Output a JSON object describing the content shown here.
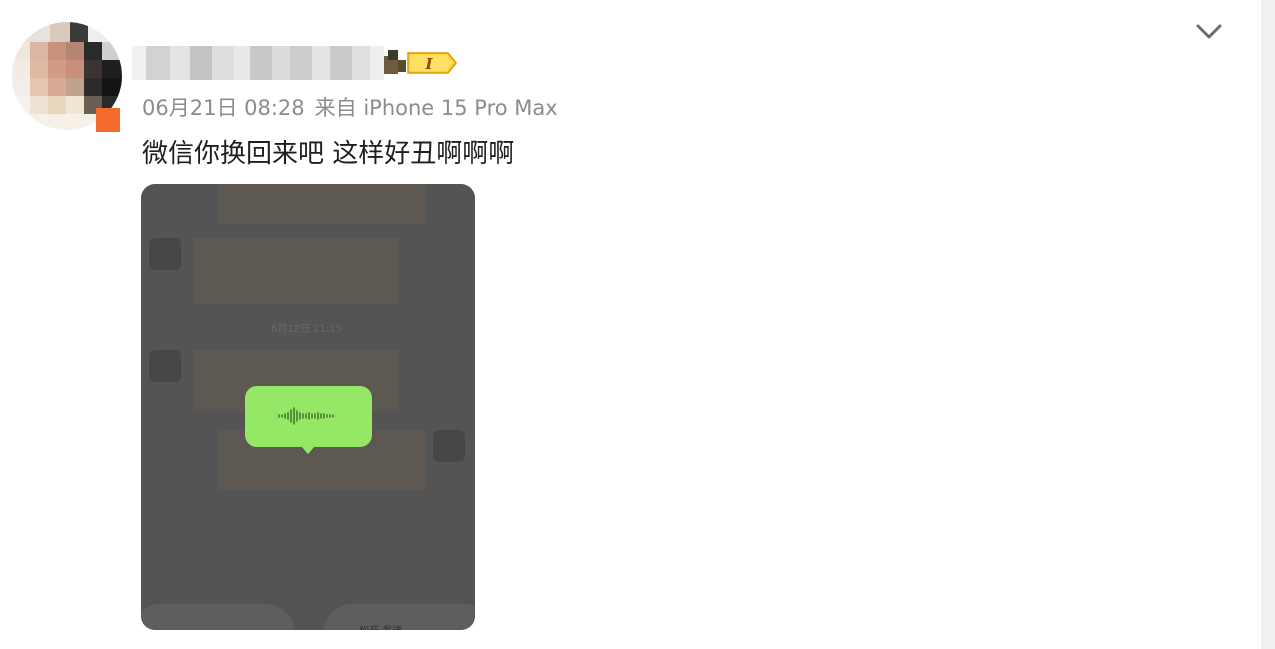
{
  "post": {
    "timestamp": "06月21日 08:28",
    "source": "来自 iPhone 15 Pro Max",
    "text": "微信你换回来吧 这样好丑啊啊啊",
    "vip_badge_label": "I"
  },
  "embedded_screenshot": {
    "recording_hint": "松开 发送",
    "tiny_timestamp": "6月12日 21:15"
  },
  "icons": {
    "more": "chevron-down-icon",
    "waveform": "waveform-icon"
  },
  "colors": {
    "voice_bubble": "#95e866",
    "overlay": "#545454",
    "avatar_badge": "#f26a2e",
    "meta_text": "#8c8c8c"
  }
}
